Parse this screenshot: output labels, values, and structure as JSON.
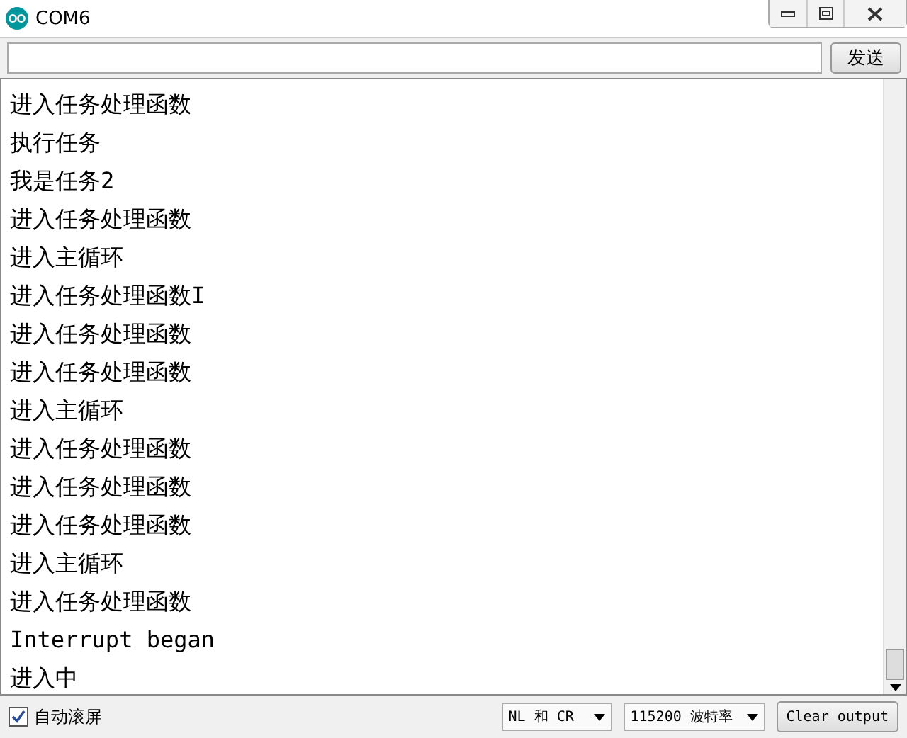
{
  "window": {
    "title": "COM6"
  },
  "send": {
    "label": "发送"
  },
  "output": {
    "lines": [
      "进入任务处理函数",
      "执行任务",
      "我是任务2",
      "进入任务处理函数",
      "进入主循环",
      "进入任务处理函数I",
      "进入任务处理函数",
      "进入任务处理函数",
      "进入主循环",
      "进入任务处理函数",
      "进入任务处理函数",
      "进入任务处理函数",
      "进入主循环",
      "进入任务处理函数",
      "Interrupt began",
      "进入中"
    ]
  },
  "autoscroll": {
    "label": "自动滚屏",
    "checked": true
  },
  "line_ending": {
    "value": "NL 和 CR"
  },
  "baud": {
    "value": "115200 波特率"
  },
  "clear": {
    "label": "Clear output"
  }
}
